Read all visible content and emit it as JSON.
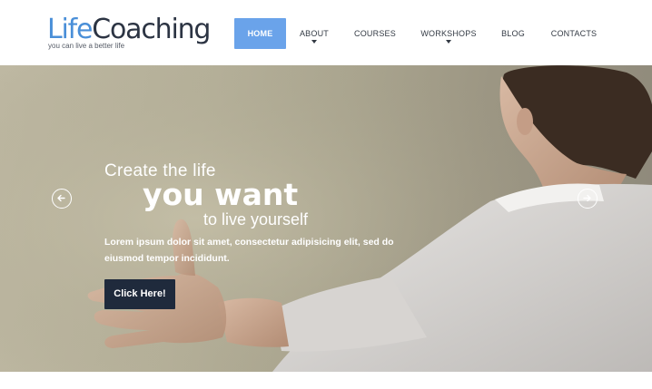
{
  "logo": {
    "part1": "Life",
    "part2": "Coaching",
    "tagline": "you can live a better life",
    "colors": {
      "life": "#4a8fd8",
      "coaching": "#2c3443"
    }
  },
  "nav": {
    "active_color": "#6aa3ea",
    "items": [
      {
        "label": "HOME",
        "active": true,
        "has_dropdown": false
      },
      {
        "label": "ABOUT",
        "active": false,
        "has_dropdown": true
      },
      {
        "label": "COURSES",
        "active": false,
        "has_dropdown": false
      },
      {
        "label": "WORKSHOPS",
        "active": false,
        "has_dropdown": true
      },
      {
        "label": "BLOG",
        "active": false,
        "has_dropdown": false
      },
      {
        "label": "CONTACTS",
        "active": false,
        "has_dropdown": false
      }
    ]
  },
  "hero": {
    "line1": "Create the life",
    "line2": "you want",
    "line3": "to live yourself",
    "description": "Lorem ipsum dolor sit amet, consectetur adipisicing elit, sed do eiusmod tempor incididunt.",
    "cta_label": "Click Here!",
    "cta_color": "#1f2a3c",
    "prev_icon": "arrow-left-circle-icon",
    "next_icon": "arrow-right-circle-icon"
  }
}
